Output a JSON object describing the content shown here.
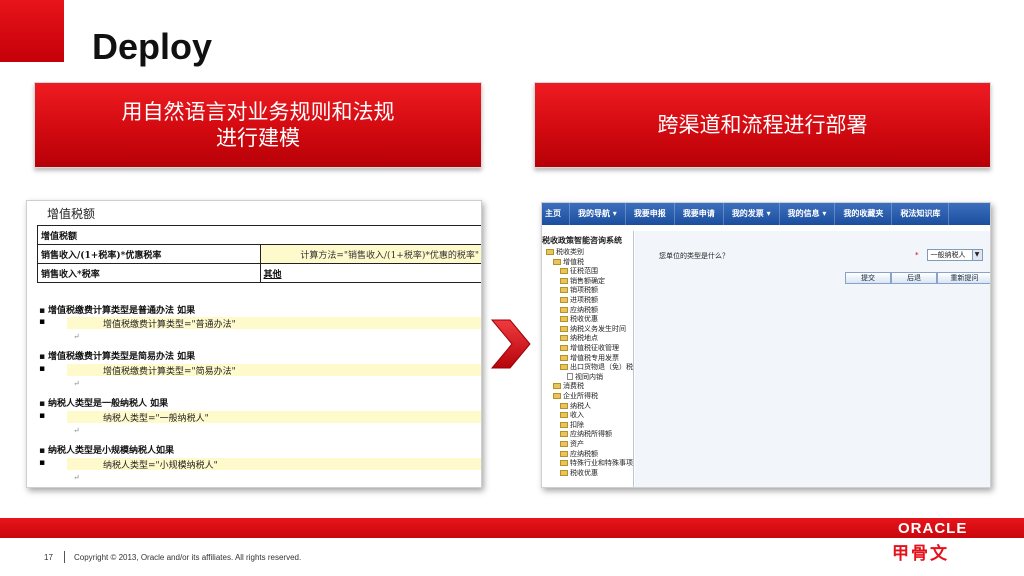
{
  "slide": {
    "title": "Deploy",
    "page_number": "17",
    "copyright": "Copyright © 2013, Oracle and/or its affiliates. All rights reserved.",
    "oracle_logo": "ORACLE",
    "cn_logo": "甲骨文"
  },
  "banners": {
    "left_line1": "用自然语言对业务规则和法规",
    "left_line2": "进行建模",
    "right": "跨渠道和流程进行部署"
  },
  "doc": {
    "header": "增值税额",
    "table": {
      "row1": "增值税额",
      "row2_left": "销售收入/(1+税率)*优惠税率",
      "row2_right": "计算方法=\"销售收入/(1+税率)*优惠的税率\"",
      "row3_left": "销售收入*税率",
      "row3_right": "其他"
    },
    "rules": [
      {
        "title": "增值税缴费计算类型是普通办法 如果",
        "condition": "增值税缴费计算类型=\"普通办法\""
      },
      {
        "title": "增值税缴费计算类型是简易办法 如果",
        "condition": "增值税缴费计算类型=\"简易办法\""
      },
      {
        "title": "纳税人类型是一般纳税人 如果",
        "condition": "纳税人类型=\"一般纳税人\""
      },
      {
        "title": "纳税人类型是小规模纳税人如果",
        "condition": "纳税人类型=\"小规模纳税人\""
      }
    ]
  },
  "app": {
    "nav": [
      "主页",
      "我的导航 ▾",
      "我要申报",
      "我要申请",
      "我的发票 ▾",
      "我的信息 ▾",
      "我的收藏夹",
      "税法知识库"
    ],
    "system_title": "税收政策智能咨询系统",
    "tree": [
      {
        "label": "税收类别",
        "level": 0,
        "kind": "folder"
      },
      {
        "label": "增值税",
        "level": 1,
        "kind": "folder"
      },
      {
        "label": "征税范围",
        "level": 2,
        "kind": "folder"
      },
      {
        "label": "销售额确定",
        "level": 2,
        "kind": "folder"
      },
      {
        "label": "销项税额",
        "level": 2,
        "kind": "folder"
      },
      {
        "label": "进项税额",
        "level": 2,
        "kind": "folder"
      },
      {
        "label": "应纳税额",
        "level": 2,
        "kind": "folder"
      },
      {
        "label": "税收优惠",
        "level": 2,
        "kind": "folder"
      },
      {
        "label": "纳税义务发生时间",
        "level": 2,
        "kind": "folder"
      },
      {
        "label": "纳税地点",
        "level": 2,
        "kind": "folder"
      },
      {
        "label": "增值税征收管理",
        "level": 2,
        "kind": "folder"
      },
      {
        "label": "增值税专用发票",
        "level": 2,
        "kind": "folder"
      },
      {
        "label": "出口货物退（免）税",
        "level": 2,
        "kind": "folder"
      },
      {
        "label": "视同内销",
        "level": 3,
        "kind": "leaf"
      },
      {
        "label": "消费税",
        "level": 1,
        "kind": "folder"
      },
      {
        "label": "企业所得税",
        "level": 1,
        "kind": "folder"
      },
      {
        "label": "纳税人",
        "level": 2,
        "kind": "folder"
      },
      {
        "label": "收入",
        "level": 2,
        "kind": "folder"
      },
      {
        "label": "扣除",
        "level": 2,
        "kind": "folder"
      },
      {
        "label": "应纳税所得额",
        "level": 2,
        "kind": "folder"
      },
      {
        "label": "资产",
        "level": 2,
        "kind": "folder"
      },
      {
        "label": "应纳税额",
        "level": 2,
        "kind": "folder"
      },
      {
        "label": "特殊行业和特殊事项",
        "level": 2,
        "kind": "folder"
      },
      {
        "label": "税收优惠",
        "level": 2,
        "kind": "folder"
      }
    ],
    "question": "您单位的类型是什么？",
    "required_mark": "*",
    "selected_value": "一般纳税人",
    "buttons": {
      "submit": "提交",
      "back": "后退",
      "reset": "重新提问"
    }
  },
  "colors": {
    "oracle_red": "#e4111a",
    "nav_blue": "#1c4e9e",
    "highlight": "#fffacc"
  }
}
